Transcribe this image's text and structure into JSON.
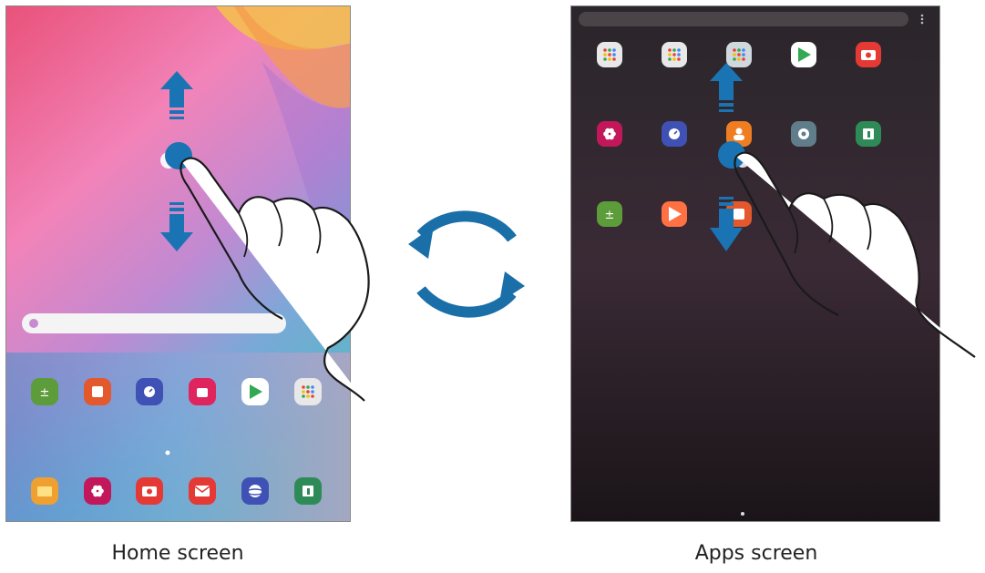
{
  "captions": {
    "home": "Home screen",
    "apps": "Apps screen"
  },
  "home_screen": {
    "search_bar": "",
    "app_row_1": [
      {
        "icon": "calculator-icon",
        "label": "",
        "color": "#5d9c3b"
      },
      {
        "icon": "notes-icon",
        "label": "",
        "color": "#e3582c"
      },
      {
        "icon": "clock-icon",
        "label": "",
        "color": "#3f51b5"
      },
      {
        "icon": "galaxy-store-icon",
        "label": "",
        "color": "#e0245e"
      },
      {
        "icon": "play-store-icon",
        "label": "",
        "color": "#ffffff"
      },
      {
        "icon": "google-folder-icon",
        "label": "",
        "color": "#e8e8e8"
      }
    ],
    "dock": [
      {
        "icon": "my-files-icon",
        "color": "#f0a030"
      },
      {
        "icon": "gallery-icon",
        "color": "#c2185b"
      },
      {
        "icon": "camera-icon",
        "color": "#e53935"
      },
      {
        "icon": "email-icon",
        "color": "#e53935"
      },
      {
        "icon": "internet-icon",
        "color": "#3f51b5"
      },
      {
        "icon": "calendar-icon",
        "color": "#2e8b57"
      }
    ]
  },
  "apps_screen": {
    "search_placeholder": "",
    "rows": [
      [
        {
          "icon": "samsung-folder-icon",
          "color": "#e8e8e8"
        },
        {
          "icon": "google-folder-icon",
          "color": "#e8e8e8"
        },
        {
          "icon": "folder-icon",
          "color": "#cfd8dc"
        },
        {
          "icon": "play-store-icon",
          "color": "#ffffff"
        },
        {
          "icon": "camera-icon",
          "color": "#e53935"
        }
      ],
      [
        {
          "icon": "gallery-icon",
          "color": "#c2185b"
        },
        {
          "icon": "clock-icon",
          "color": "#3f51b5"
        },
        {
          "icon": "contacts-icon",
          "color": "#ef7d22"
        },
        {
          "icon": "settings-icon",
          "color": "#607d8b"
        },
        {
          "icon": "calendar-icon",
          "color": "#2e8b57"
        }
      ],
      [
        {
          "icon": "calculator-icon",
          "color": "#5d9c3b"
        },
        {
          "icon": "play-music-icon",
          "color": "#ff7043"
        },
        {
          "icon": "notes-icon",
          "color": "#e3582c"
        }
      ]
    ]
  },
  "colors": {
    "accent_blue": "#1f6fa8",
    "arrow_blue": "#1a74b4"
  }
}
